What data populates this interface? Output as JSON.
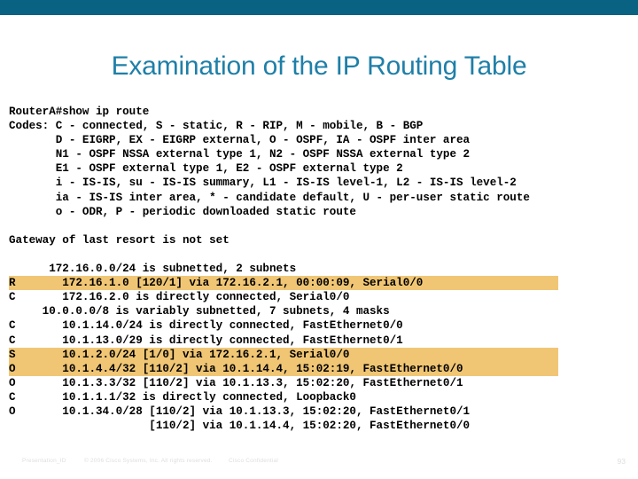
{
  "slide": {
    "title": "Examination of the IP Routing Table",
    "accent_color": "#0a6283",
    "title_color": "#1f7fa8",
    "highlight_color": "#f0c675"
  },
  "console": {
    "lines": [
      {
        "text": "RouterA#show ip route",
        "highlight": false
      },
      {
        "text": "Codes: C - connected, S - static, R - RIP, M - mobile, B - BGP",
        "highlight": false
      },
      {
        "text": "       D - EIGRP, EX - EIGRP external, O - OSPF, IA - OSPF inter area",
        "highlight": false
      },
      {
        "text": "       N1 - OSPF NSSA external type 1, N2 - OSPF NSSA external type 2",
        "highlight": false
      },
      {
        "text": "       E1 - OSPF external type 1, E2 - OSPF external type 2",
        "highlight": false
      },
      {
        "text": "       i - IS-IS, su - IS-IS summary, L1 - IS-IS level-1, L2 - IS-IS level-2",
        "highlight": false
      },
      {
        "text": "       ia - IS-IS inter area, * - candidate default, U - per-user static route",
        "highlight": false
      },
      {
        "text": "       o - ODR, P - periodic downloaded static route",
        "highlight": false
      },
      {
        "text": " ",
        "highlight": false
      },
      {
        "text": "Gateway of last resort is not set",
        "highlight": false
      },
      {
        "text": " ",
        "highlight": false
      },
      {
        "text": "      172.16.0.0/24 is subnetted, 2 subnets",
        "highlight": false
      },
      {
        "text": "R       172.16.1.0 [120/1] via 172.16.2.1, 00:00:09, Serial0/0",
        "highlight": true
      },
      {
        "text": "C       172.16.2.0 is directly connected, Serial0/0",
        "highlight": false
      },
      {
        "text": "     10.0.0.0/8 is variably subnetted, 7 subnets, 4 masks",
        "highlight": false
      },
      {
        "text": "C       10.1.14.0/24 is directly connected, FastEthernet0/0",
        "highlight": false
      },
      {
        "text": "C       10.1.13.0/29 is directly connected, FastEthernet0/1",
        "highlight": false
      },
      {
        "text": "S       10.1.2.0/24 [1/0] via 172.16.2.1, Serial0/0",
        "highlight": true
      },
      {
        "text": "O       10.1.4.4/32 [110/2] via 10.1.14.4, 15:02:19, FastEthernet0/0",
        "highlight": true
      },
      {
        "text": "O       10.1.3.3/32 [110/2] via 10.1.13.3, 15:02:20, FastEthernet0/1",
        "highlight": false
      },
      {
        "text": "C       10.1.1.1/32 is directly connected, Loopback0",
        "highlight": false
      },
      {
        "text": "O       10.1.34.0/28 [110/2] via 10.1.13.3, 15:02:20, FastEthernet0/1",
        "highlight": false
      },
      {
        "text": "                     [110/2] via 10.1.14.4, 15:02:20, FastEthernet0/0",
        "highlight": false
      }
    ]
  },
  "footer": {
    "presentation_id": "Presentation_ID",
    "copyright": "© 2006 Cisco Systems, Inc. All rights reserved.",
    "confidential": "Cisco Confidential",
    "page_number": "93"
  }
}
